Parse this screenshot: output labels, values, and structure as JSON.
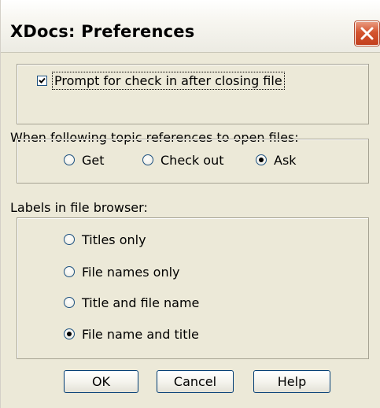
{
  "window": {
    "title": "XDocs: Preferences",
    "close_icon": "close-icon",
    "colors": {
      "face": "#ece9d8",
      "close_button": "#d4542f",
      "border": "#a6a393"
    }
  },
  "prompt_checkin": {
    "label": "Prompt for check in after closing file",
    "checked": true
  },
  "topic_refs": {
    "heading": "When following topic references to open files:",
    "options": [
      {
        "label": "Get",
        "selected": false
      },
      {
        "label": "Check out",
        "selected": false
      },
      {
        "label": "Ask",
        "selected": true
      }
    ]
  },
  "file_browser_labels": {
    "heading": "Labels in file browser:",
    "options": [
      {
        "label": "Titles only",
        "selected": false
      },
      {
        "label": "File names only",
        "selected": false
      },
      {
        "label": "Title and file name",
        "selected": false
      },
      {
        "label": "File name and title",
        "selected": true
      }
    ]
  },
  "buttons": {
    "ok": "OK",
    "cancel": "Cancel",
    "help": "Help"
  }
}
